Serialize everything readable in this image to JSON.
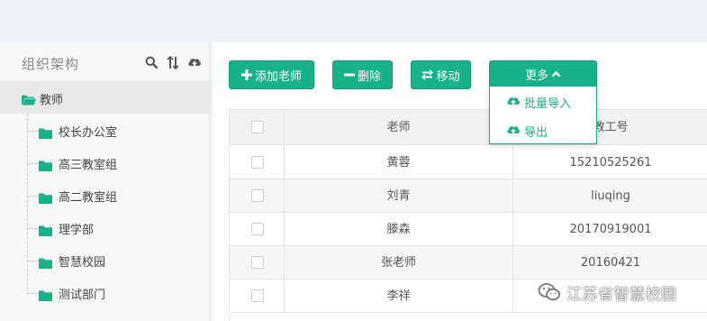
{
  "sidebar": {
    "title": "组织架构",
    "root": {
      "label": "教师"
    },
    "items": [
      {
        "label": "校长办公室"
      },
      {
        "label": "高三教室组"
      },
      {
        "label": "高二教室组"
      },
      {
        "label": "理学部"
      },
      {
        "label": "智慧校园"
      },
      {
        "label": "测试部门"
      }
    ],
    "tools": [
      "search-icon",
      "sort-icon",
      "upload-cloud-icon"
    ]
  },
  "toolbar": {
    "add_label": "添加老师",
    "delete_label": "删除",
    "move_label": "移动",
    "more_label": "更多"
  },
  "more_menu": {
    "import_label": "批量导入",
    "export_label": "导出"
  },
  "table": {
    "columns": [
      "老师",
      "教工号"
    ],
    "rows": [
      {
        "name": "黄蓉",
        "id": "15210525261"
      },
      {
        "name": "刘青",
        "id": "liuqing"
      },
      {
        "name": "滕森",
        "id": "20170919001"
      },
      {
        "name": "张老师",
        "id": "20160421"
      },
      {
        "name": "李祥",
        "id": ""
      }
    ]
  },
  "watermark": {
    "text": "江苏省智慧校园"
  },
  "colors": {
    "accent": "#17b28a",
    "top_bar": "#eef2f8",
    "sidebar_bg": "#f8f8f8"
  }
}
